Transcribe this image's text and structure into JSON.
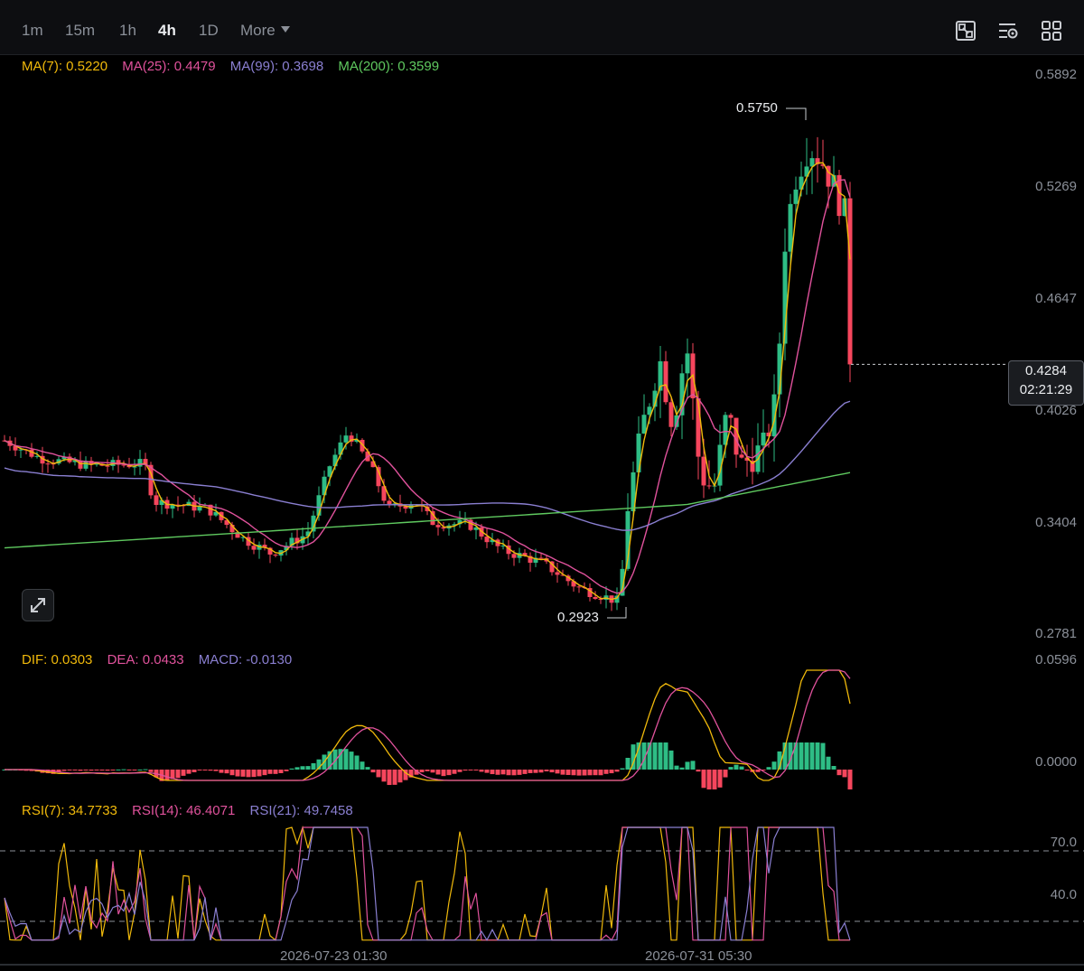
{
  "timeframes": [
    "1m",
    "15m",
    "1h",
    "4h",
    "1D"
  ],
  "active_timeframe": "4h",
  "more_label": "More",
  "toolbar_icons": [
    "chart-crop-icon",
    "chart-settings-icon",
    "layout-grid-icon"
  ],
  "ma_legend": {
    "ma7": "MA(7): 0.5220",
    "ma25": "MA(25): 0.4479",
    "ma99": "MA(99): 0.3698",
    "ma200": "MA(200): 0.3599"
  },
  "macd_legend": {
    "dif": "DIF: 0.0303",
    "dea": "DEA: 0.0433",
    "macd": "MACD: -0.0130"
  },
  "rsi_legend": {
    "rsi7": "RSI(7): 34.7733",
    "rsi14": "RSI(14): 46.4071",
    "rsi21": "RSI(21): 49.7458"
  },
  "price_axis": [
    "0.5892",
    "0.5269",
    "0.4647",
    "0.4026",
    "0.3404",
    "0.2781"
  ],
  "macd_axis": [
    "0.0596",
    "0.0000"
  ],
  "rsi_axis": [
    "70.0",
    "40.0"
  ],
  "current_price": "0.4284",
  "countdown": "02:21:29",
  "high_label": "0.5750",
  "low_label": "0.2923",
  "dates": [
    "2026-07-23 01:30",
    "2026-07-31 05:30"
  ],
  "colors": {
    "up": "#2ebd85",
    "down": "#f6465d",
    "ma7": "#f0b90b",
    "ma25": "#e0529c",
    "ma99": "#8a7fd1",
    "ma200": "#5fc95f",
    "dif": "#f0b90b",
    "dea": "#e0529c"
  },
  "chart_data": {
    "type": "candlestick",
    "price_range": [
      0.2781,
      0.5892
    ],
    "high": 0.575,
    "low": 0.2923,
    "last": 0.4284,
    "ma": {
      "MA7": 0.522,
      "MA25": 0.4479,
      "MA99": 0.3698,
      "MA200": 0.3599
    },
    "macd": {
      "DIF": 0.0303,
      "DEA": 0.0433,
      "MACD": -0.013
    },
    "rsi": {
      "RSI7": 34.7733,
      "RSI14": 46.4071,
      "RSI21": 49.7458
    },
    "rsi_levels": [
      70.0,
      40.0
    ]
  }
}
